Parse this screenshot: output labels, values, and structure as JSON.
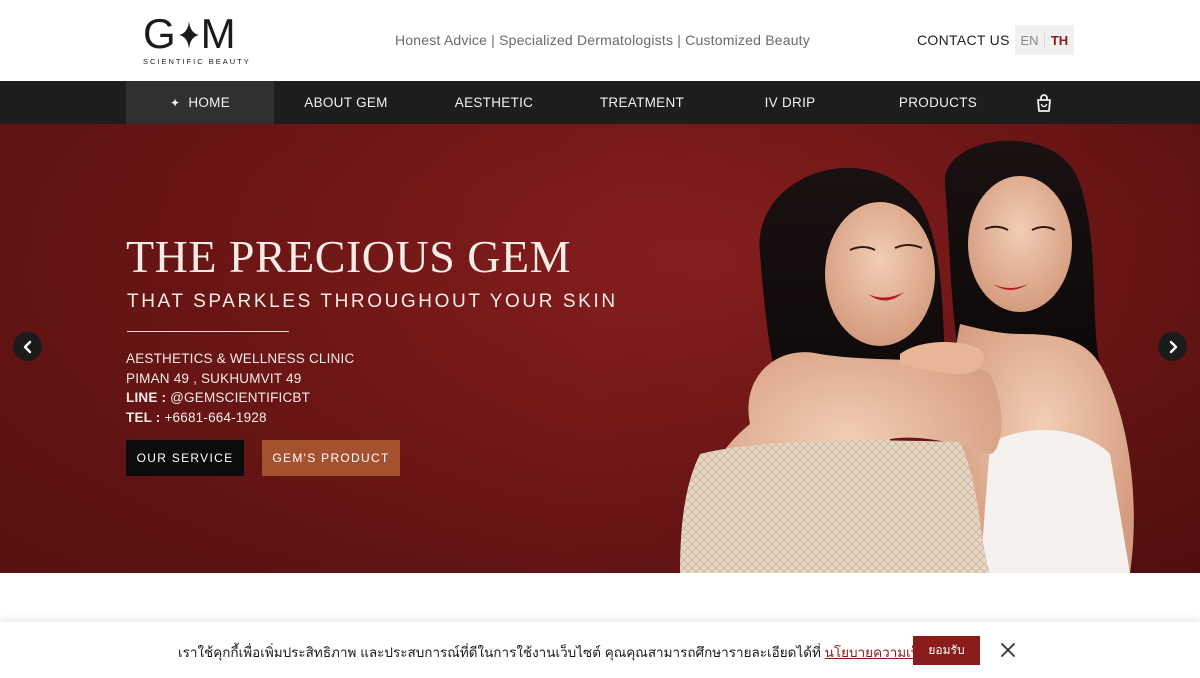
{
  "header": {
    "logo_text": "GEM",
    "logo_sub": "SCIENTIFIC BEAUTY",
    "tagline": "Honest Advice | Specialized Dermatologists | Customized Beauty",
    "contact_label": "CONTACT US",
    "lang": {
      "en": "EN",
      "th": "TH",
      "active": "TH"
    }
  },
  "nav": {
    "items": [
      {
        "label": "HOME",
        "active": true
      },
      {
        "label": "ABOUT GEM"
      },
      {
        "label": "AESTHETIC"
      },
      {
        "label": "TREATMENT"
      },
      {
        "label": "IV DRIP"
      },
      {
        "label": "PRODUCTS"
      }
    ],
    "cart_icon": "shopping-bag-icon"
  },
  "hero": {
    "title": "THE PRECIOUS GEM",
    "subtitle": "THAT SPARKLES THROUGHOUT YOUR SKIN",
    "clinic": "AESTHETICS & WELLNESS CLINIC",
    "address": "PIMAN 49 , SUKHUMVIT 49",
    "line_label": "LINE :",
    "line_value": "@GEMSCIENTIFICBT",
    "tel_label": "TEL :",
    "tel_value": "+6681-664-1928",
    "btn_service": "OUR SERVICE",
    "btn_product": "GEM'S PRODUCT"
  },
  "cookie": {
    "message": "เราใช้คุกกี้เพื่อเพิ่มประสิทธิภาพ และประสบการณ์ที่ดีในการใช้งานเว็บไซต์ คุณคุณสามารถศึกษารายละเอียดได้ที่ ",
    "link": "นโยบายความเป็นส่วนตัว",
    "accept": "ยอมรับ"
  },
  "colors": {
    "brand_red": "#8b1c1c",
    "nav_bg": "#1d1d1d",
    "product_btn": "#a5512f"
  }
}
